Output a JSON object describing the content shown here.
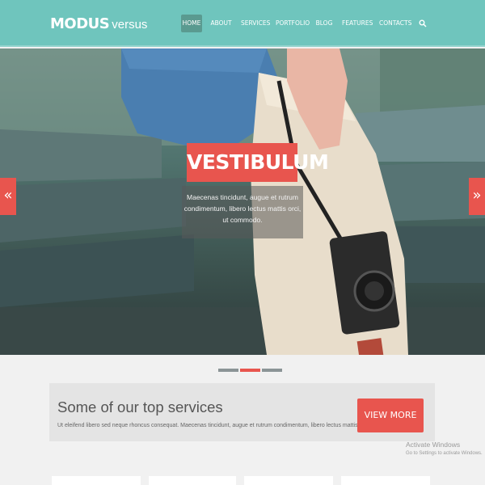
{
  "logo": {
    "main": "MODUS",
    "sub": "versus"
  },
  "nav": {
    "items": [
      {
        "label": "HOME",
        "active": true
      },
      {
        "label": "ABOUT",
        "active": false
      },
      {
        "label": "SERVICES",
        "active": false
      },
      {
        "label": "PORTFOLIO",
        "active": false
      },
      {
        "label": "BLOG",
        "active": false
      },
      {
        "label": "FEATURES",
        "active": false
      },
      {
        "label": "CONTACTS",
        "active": false
      }
    ],
    "search_icon": "search-icon"
  },
  "slider": {
    "title": "VESTIBULUM",
    "caption": "Maecenas tincidunt, augue et rutrum condimentum, libero lectus mattis orci, ut commodo.",
    "prev_icon": "«",
    "next_icon": "»",
    "slide_count": 3,
    "active_index": 1
  },
  "services": {
    "title": "Some of our top services",
    "description": "Ut eleifend libero sed neque rhoncus consequat. Maecenas tincidunt, augue et rutrum condimentum, libero lectus mattis orci, ut commodo.",
    "button_label": "VIEW MORE"
  },
  "os_notice": {
    "title": "Activate Windows",
    "subtitle": "Go to Settings to activate Windows."
  },
  "colors": {
    "header": "#6fc5bd",
    "accent": "#e8554e",
    "active_nav": "#5a9a90"
  }
}
